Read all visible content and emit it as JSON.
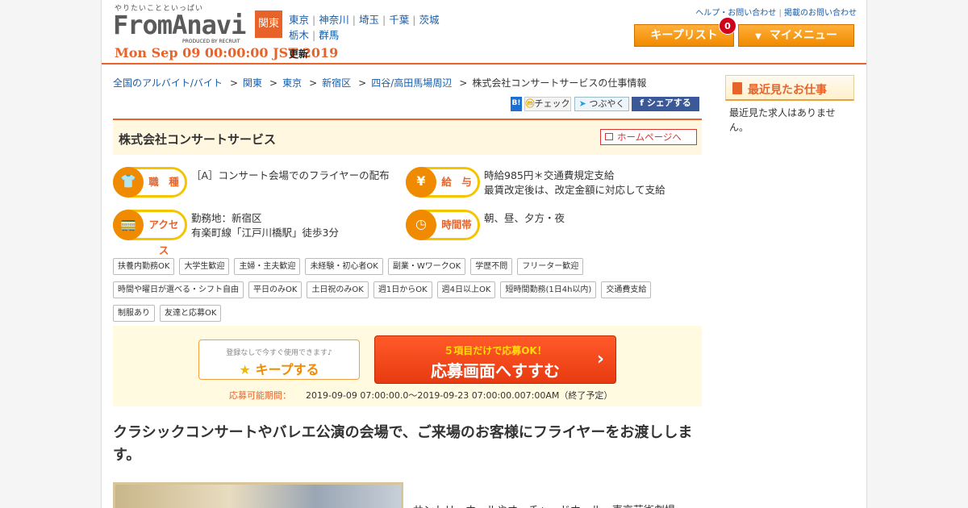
{
  "header": {
    "tagline": "やりたいことといっぱい",
    "logo_text": "FromAnavi",
    "logo_sub": "PRODUCED BY RECRUIT",
    "date": "Mon Sep 09 00:00:00 JST 2019",
    "date_suffix": "更新",
    "region_badge": "関東",
    "regions": [
      "東京",
      "神奈川",
      "埼玉",
      "千葉",
      "茨城",
      "栃木",
      "群馬"
    ],
    "help_link": "ヘルプ・お問い合わせ",
    "post_link": "掲載のお問い合わせ",
    "keeplist_label": "キープリスト",
    "keeplist_count": "0",
    "mymenu_label": "マイメニュー"
  },
  "breadcrumb": [
    "全国のアルバイト/バイト",
    "関東",
    "東京",
    "新宿区",
    "四谷/高田馬場周辺",
    "株式会社コンサートサービスの仕事情報"
  ],
  "social": {
    "hatena": "B!",
    "mixi": "チェック",
    "twitter": "つぶやく",
    "facebook": "シェアする"
  },
  "company": {
    "name": "株式会社コンサートサービス",
    "homepage_label": "ホームページへ"
  },
  "info": {
    "job_type": {
      "label": "職　種",
      "icon": "shirt-icon",
      "text": "［A］コンサート会場でのフライヤーの配布"
    },
    "salary": {
      "label": "給　与",
      "icon": "yen-icon",
      "line1": "時給985円＊交通費規定支給",
      "line2": "最賃改定後は、改定金額に対応して支給"
    },
    "access": {
      "label": "アクセス",
      "icon": "train-icon",
      "line1": "勤務地：新宿区",
      "line2": "有楽町線「江戸川橋駅」徒歩3分"
    },
    "hours": {
      "label": "時間帯",
      "icon": "clock-icon",
      "text": "朝、昼、夕方・夜"
    }
  },
  "tags": [
    "扶養内勤務OK",
    "大学生歓迎",
    "主婦・主夫歓迎",
    "未経験・初心者OK",
    "副業・WワークOK",
    "学歴不問",
    "フリーター歓迎",
    "時間や曜日が選べる・シフト自由",
    "平日のみOK",
    "土日祝のみOK",
    "週1日からOK",
    "週4日以上OK",
    "短時間勤務(1日4h以内)",
    "交通費支給",
    "制服あり",
    "友達と応募OK"
  ],
  "apply": {
    "keep_note": "登録なしで今すぐ使用できます♪",
    "keep_label": "キープする",
    "apply_note": "５項目だけで応募OK！",
    "apply_label": "応募画面へすすむ",
    "period_label": "応募可能期間：",
    "period_value": "2019-09-09 07:00:00.0～2019-09-23 07:00:00.007:00AM（終了予定）"
  },
  "catch_copy": "クラシックコンサートやバレエ公演の会場で、ご来場のお客様にフライヤーをお渡しします。",
  "body_text": "サントリーホールやオーチャードホール、東京芸術劇場",
  "sidebar": {
    "title": "最近見たお仕事",
    "empty_text": "最近見た求人はありません。"
  }
}
